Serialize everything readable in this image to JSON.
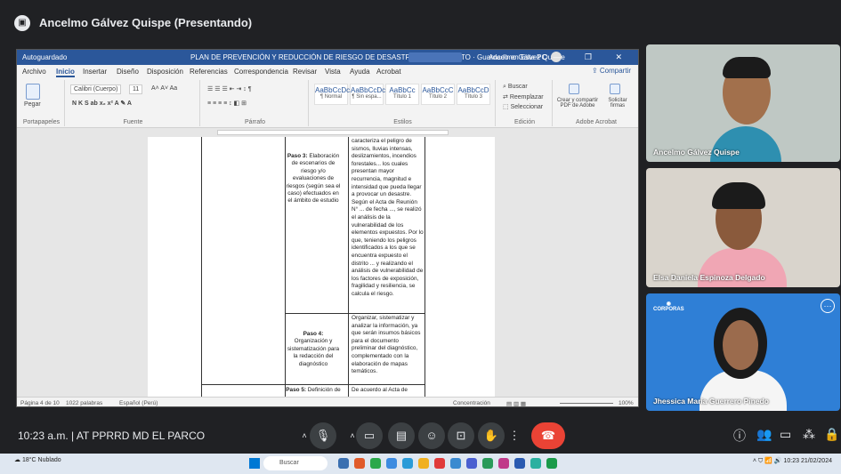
{
  "meeting": {
    "presenter_label": "Ancelmo Gálvez Quispe (Presentando)",
    "time": "10:23 a.m.",
    "separator": "|",
    "meeting_name": "AT PPRRD MD EL PARCO"
  },
  "word": {
    "autosave": "Autoguardado",
    "doc_title": "PLAN DE PREVENCIÓN Y REDUCCIÓN DE RIESGO DE DESASTRES DEL DISTRITO · Guardado en Este PC",
    "user": "Ancelmo Gálvez Quispe",
    "window_controls": "— ❐ ✕",
    "menu": [
      "Archivo",
      "Inicio",
      "Insertar",
      "Diseño",
      "Disposición",
      "Referencias",
      "Correspondencia",
      "Revisar",
      "Vista",
      "Ayuda",
      "Acrobat"
    ],
    "share": "Compartir",
    "ribbon": {
      "paste": "Pegar",
      "font_name": "Calibri (Cuerpo)",
      "font_size": "11",
      "groups": [
        "Portapapeles",
        "Fuente",
        "Párrafo",
        "Estilos",
        "Edición",
        "Adobe Acrobat"
      ],
      "styles": [
        {
          "preview": "AaBbCcDc",
          "label": "¶ Normal"
        },
        {
          "preview": "AaBbCcDc",
          "label": "¶ Sin espa..."
        },
        {
          "preview": "AaBbCc",
          "label": "Título 1"
        },
        {
          "preview": "AaBbCcC",
          "label": "Título 2"
        },
        {
          "preview": "AaBbCcD",
          "label": "Título 3"
        }
      ],
      "edit": [
        "Buscar",
        "Reemplazar",
        "Seleccionar"
      ],
      "acrobat": [
        "Crear y compartir PDF de Adobe",
        "Solicitar firmas"
      ]
    },
    "table": {
      "row3_step": "Paso 3:",
      "row3_title": "Elaboración de escenarios de riesgo y/o evaluaciones de riesgos (según sea el caso) efectuados en el ámbito de estudio",
      "row3_text": "caracteriza el peligro de sismos, lluvias intensas, deslizamientos, incendios forestales... los cuales presentan mayor recurrencia, magnitud e intensidad que pueda llegar a provocar un desastre. Según el Acta de Reunión N° ... de fecha ..., se realizó el análisis de la vulnerabilidad de los elementos expuestos. Por lo que, teniendo los peligros identificados a los que se encuentra expuesto el distrito ... y realizando el análisis de vulnerabilidad de los factores de exposición, fragilidad y resiliencia, se calcula el riesgo.",
      "row4_step": "Paso 4:",
      "row4_title": "Organización y sistematización para la redacción del diagnóstico",
      "row4_text": "Organizar, sistematizar y analizar la información, ya que serán insumos básicos para el documento preliminar del diagnóstico, complementado con la elaboración de mapas temáticos.",
      "row5_step": "Paso 5:",
      "row5_title": "Definición de",
      "row5_text": "De acuerdo al Acta de"
    },
    "status": {
      "page": "Página 4 de 10",
      "words": "1022 palabras",
      "lang": "Español (Perú)",
      "focus": "Concentración",
      "zoom": "100%"
    }
  },
  "participants": [
    {
      "name": "Ancelmo Gálvez Quispe"
    },
    {
      "name": "Elsa Daniela Espinoza Delgado"
    },
    {
      "name": "Jhessica María Guerrero Pinedo",
      "logo": "CORPORAS"
    }
  ],
  "taskbar": {
    "temp": "18°C",
    "weather": "Nublado",
    "search": "Buscar",
    "clock_time": "10:23",
    "clock_date": "21/02/2024"
  },
  "colors": {
    "word_blue": "#2b579a",
    "meet_bg": "#202124",
    "hangup": "#ea4335"
  }
}
